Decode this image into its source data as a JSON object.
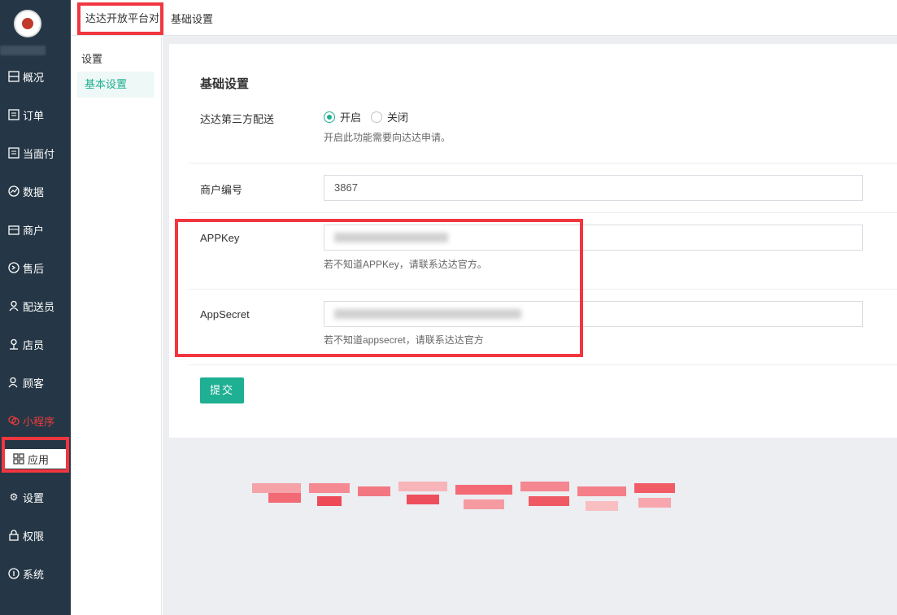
{
  "sidebar": {
    "items": [
      {
        "label": "概况",
        "icon": "overview-icon"
      },
      {
        "label": "订单",
        "icon": "order-icon"
      },
      {
        "label": "当面付",
        "icon": "facepay-icon"
      },
      {
        "label": "数据",
        "icon": "chart-icon"
      },
      {
        "label": "商户",
        "icon": "store-icon"
      },
      {
        "label": "售后",
        "icon": "aftersale-icon"
      },
      {
        "label": "配送员",
        "icon": "courier-icon"
      },
      {
        "label": "店员",
        "icon": "staff-icon"
      },
      {
        "label": "顾客",
        "icon": "customer-icon"
      },
      {
        "label": "小程序",
        "icon": "miniprogram-icon"
      },
      {
        "label": "应用",
        "icon": "apps-icon"
      },
      {
        "label": "设置",
        "icon": "gear-icon"
      },
      {
        "label": "权限",
        "icon": "lock-icon"
      },
      {
        "label": "系统",
        "icon": "system-icon"
      }
    ],
    "accent_red": "#ef3b3b"
  },
  "subnav": {
    "title": "设置",
    "items": [
      {
        "label": "基本设置"
      }
    ]
  },
  "tabs": [
    {
      "label": "达达开放平台对"
    },
    {
      "label": "基础设置"
    }
  ],
  "form": {
    "title": "基础设置",
    "delivery": {
      "label": "达达第三方配送",
      "options": [
        "开启",
        "关闭"
      ],
      "selected": "开启",
      "help": "开启此功能需要向达达申请。"
    },
    "merchant_id": {
      "label": "商户编号",
      "value": "3867"
    },
    "appkey": {
      "label": "APPKey",
      "help": "若不知道APPKey，请联系达达官方。"
    },
    "appsecret": {
      "label": "AppSecret",
      "help": "若不知道appsecret，请联系达达官方"
    },
    "submit_label": "提交"
  },
  "colors": {
    "primary": "#1faf92",
    "sidebar_bg": "#253746",
    "highlight_box": "#f2363f"
  }
}
